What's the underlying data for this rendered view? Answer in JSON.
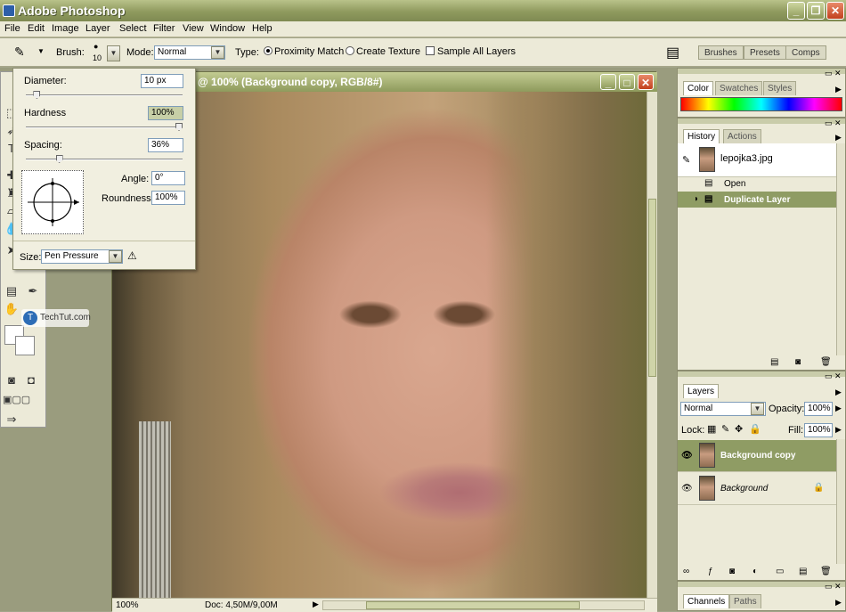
{
  "app": {
    "title": "Adobe Photoshop"
  },
  "menu": [
    "File",
    "Edit",
    "Image",
    "Layer",
    "Select",
    "Filter",
    "View",
    "Window",
    "Help"
  ],
  "options": {
    "brush_label": "Brush:",
    "brush_size": "10",
    "mode_label": "Mode:",
    "mode_value": "Normal",
    "type_label": "Type:",
    "proximity": "Proximity Match",
    "texture": "Create Texture",
    "sample_all": "Sample All Layers"
  },
  "wells": [
    "Brushes",
    "Presets",
    "Comps"
  ],
  "brush_popup": {
    "diameter_label": "Diameter:",
    "diameter_value": "10 px",
    "diameter_fraction": 0.05,
    "hardness_label": "Hardness",
    "hardness_value": "100%",
    "hardness_fraction": 1.0,
    "spacing_label": "Spacing:",
    "spacing_value": "36%",
    "spacing_fraction": 0.2,
    "angle_label": "Angle:",
    "angle_value": "0°",
    "roundness_label": "Roundness:",
    "roundness_value": "100%",
    "size_label": "Size:",
    "size_value": "Pen Pressure"
  },
  "document": {
    "title": "@ 100% (Background copy, RGB/8#)",
    "zoom": "100%",
    "doc_info": "Doc: 4,50M/9,00M"
  },
  "watermark": "TechTut.com",
  "color_panel": {
    "tabs": [
      "Color",
      "Swatches",
      "Styles"
    ]
  },
  "history_panel": {
    "tabs": [
      "History",
      "Actions"
    ],
    "snapshot": "lepojka3.jpg",
    "steps": [
      "Open",
      "Duplicate Layer"
    ]
  },
  "layers_panel": {
    "tab": "Layers",
    "blend_mode": "Normal",
    "opacity_label": "Opacity:",
    "opacity": "100%",
    "lock_label": "Lock:",
    "fill_label": "Fill:",
    "fill": "100%",
    "layers": [
      "Background copy",
      "Background"
    ]
  },
  "channels_panel": {
    "tabs": [
      "Channels",
      "Paths"
    ]
  },
  "colors": {
    "accent": "#8f9c64",
    "titlebar": "#8f9a5e",
    "panel_bg": "#ecead8"
  }
}
